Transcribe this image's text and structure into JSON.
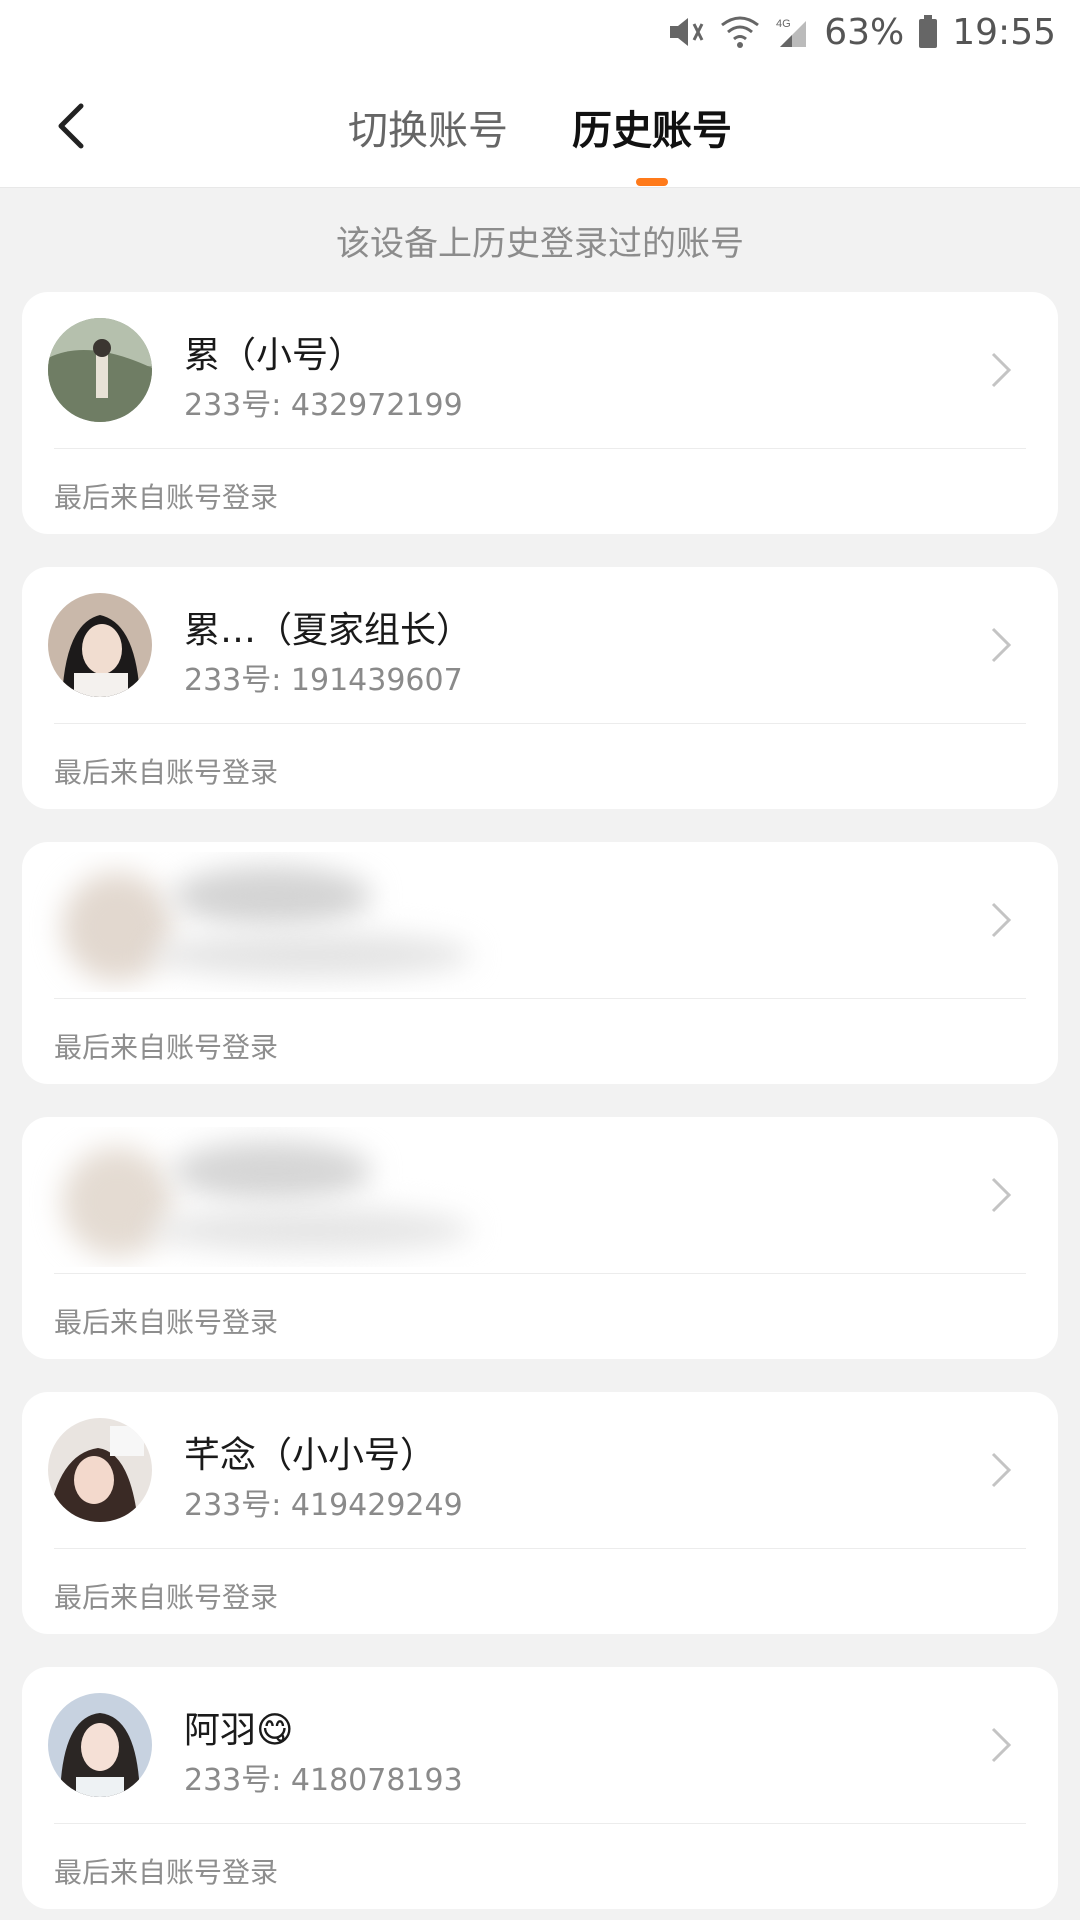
{
  "status_bar": {
    "battery": "63%",
    "time": "19:55",
    "network": "4G"
  },
  "nav": {
    "tabs": [
      "切换账号",
      "历史账号"
    ],
    "active_tab": "历史账号"
  },
  "subtitle": "该设备上历史登录过的账号",
  "accounts": [
    {
      "name": "累（小号）",
      "uid": "233号: 432972199",
      "login_source": "最后来自账号登录",
      "blurred": false
    },
    {
      "name": "累…（夏家组长）",
      "uid": "233号: 191439607",
      "login_source": "最后来自账号登录",
      "blurred": false
    },
    {
      "name": "",
      "uid": "",
      "login_source": "最后来自账号登录",
      "blurred": true
    },
    {
      "name": "",
      "uid": "",
      "login_source": "最后来自账号登录",
      "blurred": true
    },
    {
      "name": "芊念（小小号）",
      "uid": "233号: 419429249",
      "login_source": "最后来自账号登录",
      "blurred": false
    },
    {
      "name": "阿羽😋",
      "uid": "233号: 418078193",
      "login_source": "最后来自账号登录",
      "blurred": false
    }
  ],
  "colors": {
    "accent": "#ff7a1a",
    "background": "#f2f2f2",
    "card": "#ffffff"
  }
}
